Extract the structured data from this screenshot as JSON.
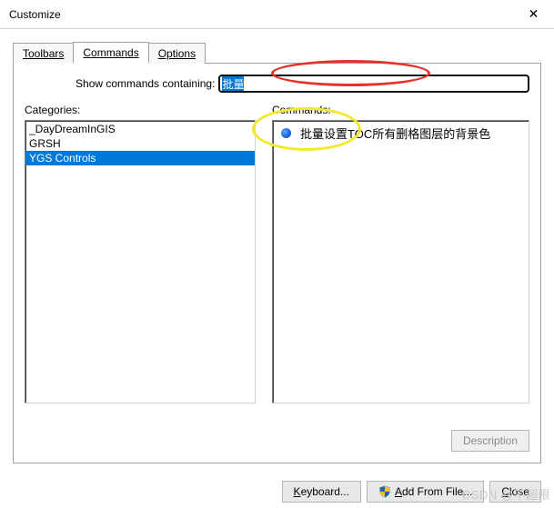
{
  "window": {
    "title": "Customize",
    "close_symbol": "✕"
  },
  "tabs": {
    "toolbars": "Toolbars",
    "commands": "Commands",
    "options": "Options"
  },
  "filter": {
    "label_pre": "S",
    "label_post": "how commands containing:",
    "value": "批量"
  },
  "labels": {
    "categories": "Categories:",
    "commands": "Commands:"
  },
  "categories": [
    "_DayDreamInGIS",
    " GRSH",
    " YGS Controls"
  ],
  "categories_selected_index": 2,
  "commands": [
    {
      "icon": "blue-dot",
      "label": "批量设置TOC所有删格图层的背景色"
    }
  ],
  "buttons": {
    "description": "Description",
    "keyboard_pre": "K",
    "keyboard_post": "eyboard...",
    "addfromfile_pre": "A",
    "addfromfile_post": "dd From File...",
    "close_pre": "C",
    "close_post": "lose"
  },
  "watermark": "CSDN @不超限"
}
